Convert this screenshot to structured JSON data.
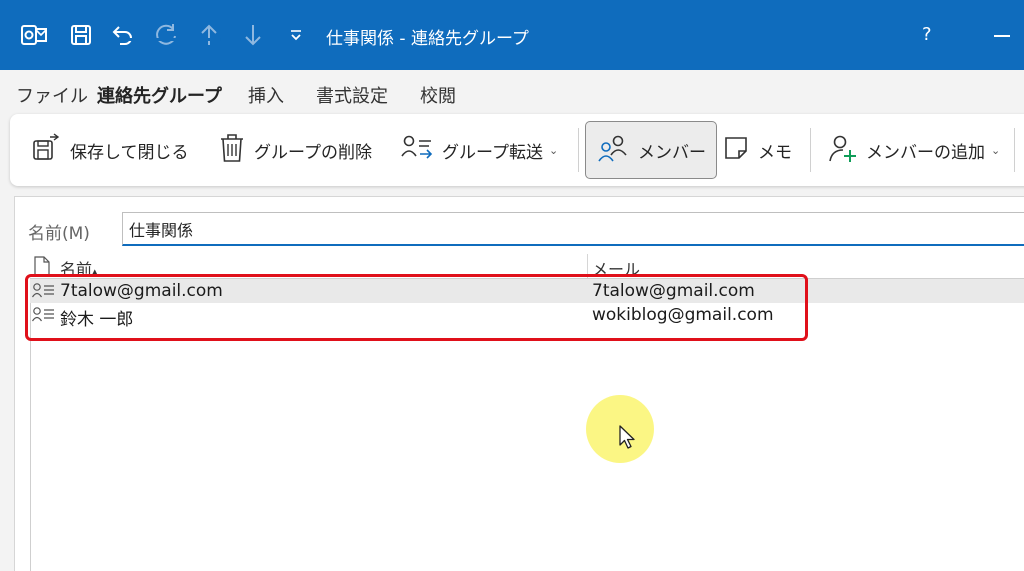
{
  "titlebar": {
    "title": "仕事関係  -  連絡先グループ",
    "help": "?",
    "icons": [
      "outlook-app-icon",
      "save-icon",
      "undo-icon",
      "redo-icon",
      "up-arrow-icon",
      "down-arrow-icon",
      "quick-access-dropdown-icon"
    ]
  },
  "menu": {
    "tabs": [
      "ファイル",
      "連絡先グループ",
      "挿入",
      "書式設定",
      "校閲"
    ],
    "active_index": 1
  },
  "ribbon": {
    "save_close": "保存して閉じる",
    "delete_group": "グループの削除",
    "forward_group": "グループ転送",
    "members": "メンバー",
    "notes": "メモ",
    "add_members": "メンバーの追加"
  },
  "form": {
    "name_label": "名前(M)",
    "name_value": "仕事関係"
  },
  "list": {
    "columns": [
      "名前",
      "メール"
    ],
    "sort_indicator": "▴",
    "rows": [
      {
        "name": "7talow@gmail.com",
        "email": "7talow@gmail.com"
      },
      {
        "name": "鈴木 一郎",
        "email": "wokiblog@gmail.com"
      }
    ]
  },
  "colors": {
    "titlebar": "#0f6cbd",
    "accent": "#0f6cbd",
    "highlight": "#e0101a",
    "cursor_glow": "#faf56e"
  }
}
